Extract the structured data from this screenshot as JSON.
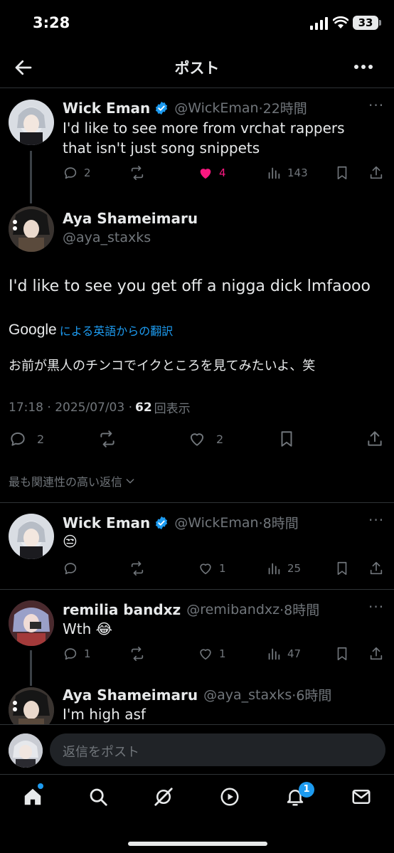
{
  "status_bar": {
    "time": "3:28",
    "battery": "33"
  },
  "nav": {
    "title": "ポスト"
  },
  "parent_tweet": {
    "name": "Wick Eman",
    "handle": "@WickEman",
    "time": "·22時間",
    "text": "I'd like to see more from vrchat rappers that isn't just song snippets",
    "replies": "2",
    "likes": "4",
    "views": "143"
  },
  "main_tweet": {
    "name": "Aya Shameimaru",
    "handle": "@aya_staxks",
    "text": "I'd like to see you get off a nigga dick lmfaooo",
    "translate_brand": "Google",
    "translate_label": "による英語からの翻訳",
    "translation": "お前が黒人のチンコでイクところを見てみたいよ、笑",
    "timestamp": "17:18 · 2025/07/03 · ",
    "views_count": "62",
    "views_label": "回表示",
    "replies": "2",
    "likes": "2"
  },
  "sort": {
    "label": "最も関連性の高い返信"
  },
  "replies": [
    {
      "name": "Wick Eman",
      "handle": "@WickEman",
      "time": "·8時間",
      "text": "😒",
      "replies": "",
      "likes": "1",
      "views": "25"
    },
    {
      "name": "remilia bandxz",
      "handle": "@remibandxz",
      "time": "·8時間",
      "text": "Wth 😂",
      "replies": "1",
      "likes": "1",
      "views": "47"
    },
    {
      "name": "Aya Shameimaru",
      "handle": "@aya_staxks",
      "time": "·6時間",
      "text": "I'm high asf"
    }
  ],
  "compose": {
    "placeholder": "返信をポスト"
  },
  "tabbar": {
    "notification_badge": "1"
  },
  "colors": {
    "background": "#000000",
    "text": "#e7e9ea",
    "muted": "#71767b",
    "like": "#f91880",
    "verified": "#1d9bf0",
    "badge": "#1d9bf0"
  }
}
